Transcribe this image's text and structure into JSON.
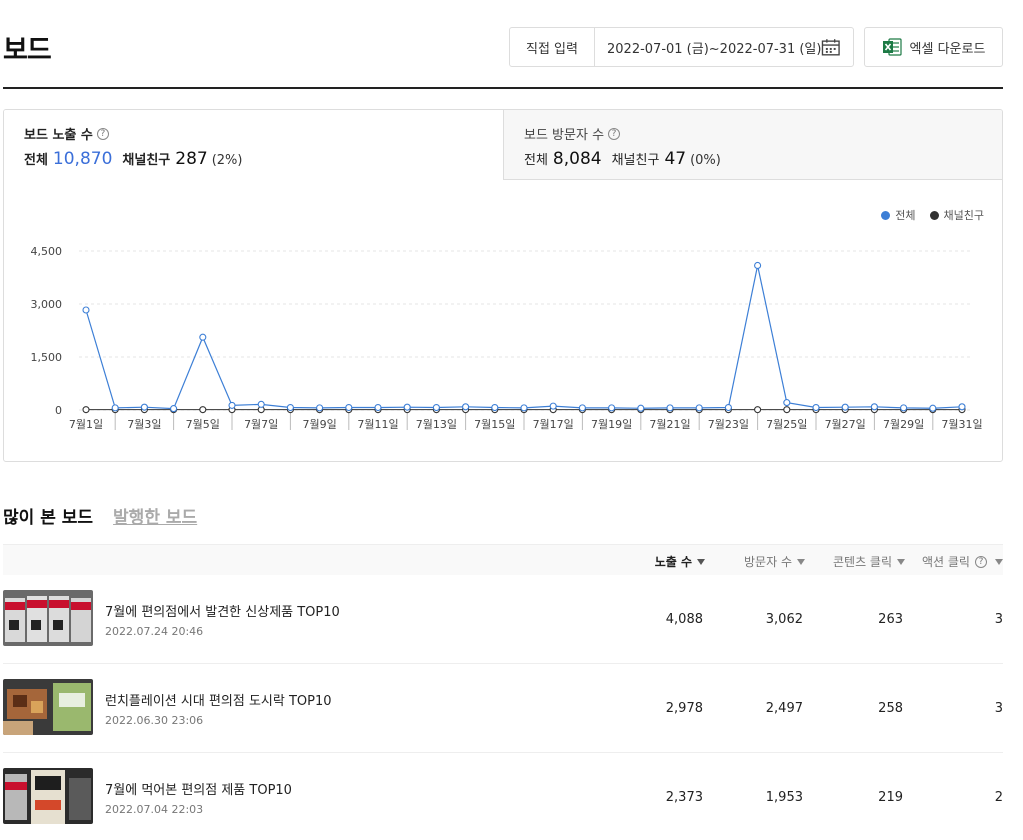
{
  "header": {
    "title": "보드",
    "date_mode": "직접 입력",
    "date_range": "2022-07-01 (금)~2022-07-31 (일)",
    "excel_label": "엑셀 다운로드"
  },
  "stats": {
    "tab1": {
      "title": "보드 노출 수",
      "total_label": "전체",
      "total": "10,870",
      "friend_label": "채널친구",
      "friend": "287",
      "pct": "(2%)"
    },
    "tab2": {
      "title": "보드 방문자 수",
      "total_label": "전체",
      "total": "8,084",
      "friend_label": "채널친구",
      "friend": "47",
      "pct": "(0%)"
    }
  },
  "colors": {
    "series_total": "#3d7fd6",
    "series_friend": "#333333",
    "accent": "#3b6fd9"
  },
  "chart_data": {
    "type": "line",
    "x": [
      "7월1일",
      "7월2일",
      "7월3일",
      "7월4일",
      "7월5일",
      "7월6일",
      "7월7일",
      "7월8일",
      "7월9일",
      "7월10일",
      "7월11일",
      "7월12일",
      "7월13일",
      "7월14일",
      "7월15일",
      "7월16일",
      "7월17일",
      "7월18일",
      "7월19일",
      "7월20일",
      "7월21일",
      "7월22일",
      "7월23일",
      "7월24일",
      "7월25일",
      "7월26일",
      "7월27일",
      "7월28일",
      "7월29일",
      "7월30일",
      "7월31일"
    ],
    "xticks": [
      "7월1일",
      "7월3일",
      "7월5일",
      "7월7일",
      "7월9일",
      "7월11일",
      "7월13일",
      "7월15일",
      "7월17일",
      "7월19일",
      "7월21일",
      "7월23일",
      "7월25일",
      "7월27일",
      "7월29일",
      "7월31일"
    ],
    "yticks": [
      "0",
      "1,500",
      "3,000",
      "4,500"
    ],
    "ylim": [
      0,
      4500
    ],
    "grid": true,
    "legend_position": "top-right",
    "series": [
      {
        "name": "전체",
        "values": [
          2830,
          60,
          80,
          40,
          2060,
          130,
          160,
          70,
          60,
          70,
          70,
          80,
          70,
          90,
          70,
          60,
          110,
          60,
          60,
          50,
          60,
          60,
          70,
          4090,
          210,
          70,
          80,
          90,
          60,
          50,
          90
        ]
      },
      {
        "name": "채널친구",
        "values": [
          10,
          10,
          10,
          10,
          10,
          10,
          10,
          10,
          10,
          10,
          10,
          10,
          10,
          10,
          10,
          10,
          10,
          10,
          10,
          10,
          10,
          10,
          10,
          10,
          10,
          10,
          10,
          10,
          10,
          10,
          10
        ]
      }
    ]
  },
  "section": {
    "active_tab": "많이 본 보드",
    "other_tab": "발행한 보드"
  },
  "table": {
    "columns": [
      "노출 수",
      "방문자 수",
      "콘텐츠 클릭",
      "액션 클릭"
    ],
    "rows": [
      {
        "title": "7월에 편의점에서 발견한 신상제품 TOP10",
        "date": "2022.07.24 20:46",
        "impressions": "4,088",
        "visitors": "3,062",
        "content_clicks": "263",
        "action_clicks": "3"
      },
      {
        "title": "런치플레이션 시대 편의점 도시락 TOP10",
        "date": "2022.06.30 23:06",
        "impressions": "2,978",
        "visitors": "2,497",
        "content_clicks": "258",
        "action_clicks": "3"
      },
      {
        "title": "7월에 먹어본 편의점 제품 TOP10",
        "date": "2022.07.04 22:03",
        "impressions": "2,373",
        "visitors": "1,953",
        "content_clicks": "219",
        "action_clicks": "2"
      }
    ]
  }
}
